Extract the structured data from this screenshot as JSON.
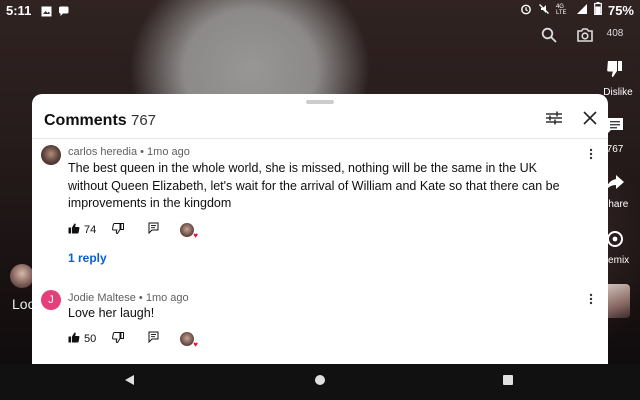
{
  "status_bar": {
    "time": "5:11",
    "network": "4G LTE",
    "battery": "75%"
  },
  "video": {
    "rail": {
      "count_label": "408",
      "dislike_label": "Dislike",
      "comments_count": "767",
      "share_label": "Share",
      "remix_label": "Remix"
    },
    "overlay_text": "Loo"
  },
  "comments_panel": {
    "title": "Comments",
    "count": "767",
    "comments": [
      {
        "author": "carlos heredia",
        "time": "1mo ago",
        "meta": "carlos heredia • 1mo ago",
        "text": "The best queen in the whole world, she is missed, nothing will be the same in the UK without Queen Elizabeth, let's wait for the arrival of William and Kate so that there can be improvements in the kingdom",
        "likes": "74",
        "replies_label": "1 reply"
      },
      {
        "author": "Jodie Maltese",
        "avatar_letter": "J",
        "time": "1mo ago",
        "meta": "Jodie Maltese • 1mo ago",
        "text": "Love her laugh!",
        "likes": "50"
      }
    ]
  },
  "colors": {
    "accent_link": "#065fd4",
    "avatar_pink": "#e43f7a",
    "heart_red": "#e0143c"
  }
}
